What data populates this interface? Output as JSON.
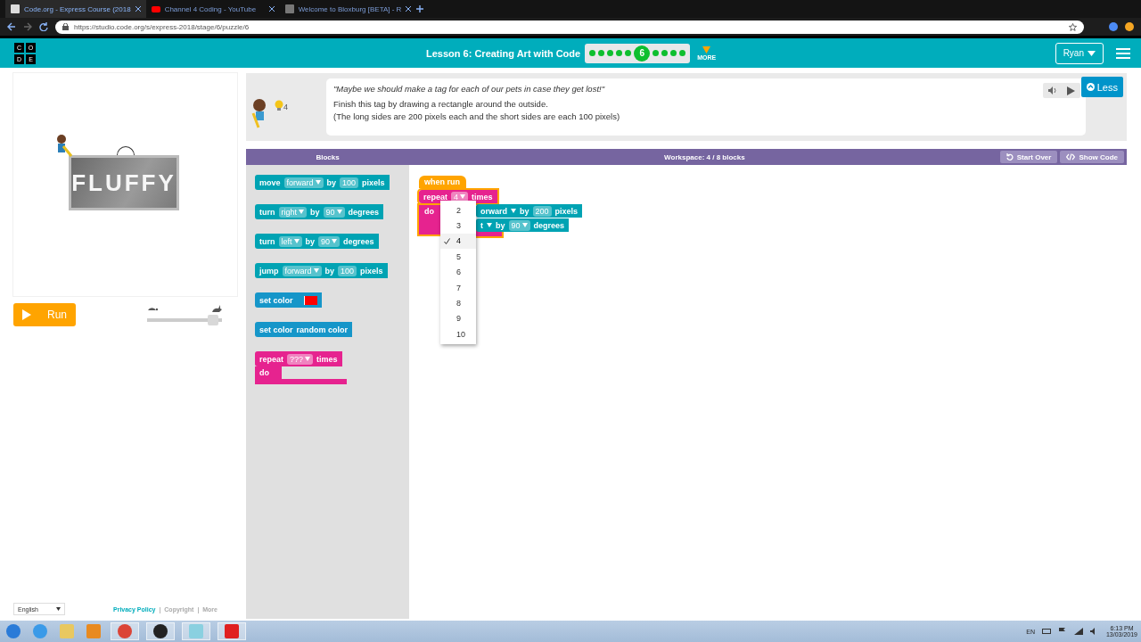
{
  "browser": {
    "tabs": [
      {
        "title": "Code.org - Express Course (2018",
        "selected": true
      },
      {
        "title": "Channel 4 Coding - YouTube",
        "selected": false
      },
      {
        "title": "Welcome to Bloxburg [BETA] - R",
        "selected": false
      }
    ],
    "url": "https://studio.code.org/s/express-2018/stage/6/puzzle/6"
  },
  "header": {
    "logo": [
      "C",
      "O",
      "D",
      "E"
    ],
    "lesson_title": "Lesson 6: Creating Art with Code",
    "progress": [
      {
        "selected": false
      },
      {
        "selected": false
      },
      {
        "selected": false
      },
      {
        "selected": false
      },
      {
        "selected": false
      },
      {
        "selected": true,
        "label": "6"
      },
      {
        "selected": false
      },
      {
        "selected": false
      },
      {
        "selected": false
      },
      {
        "selected": false
      }
    ],
    "more_label": "MORE",
    "user": "Ryan"
  },
  "stage": {
    "tag_text": "FLUFFY",
    "run_button": "Run",
    "speed": {
      "level": 0.88
    }
  },
  "instructions": {
    "hint_count": "4",
    "quote": "\"Maybe we should make a tag for each of our pets in case they get lost!\"",
    "lines": [
      "Finish this tag by drawing a rectangle around the outside.",
      "(The long sides are 200 pixels each and the short sides are each 100 pixels)"
    ],
    "less_button": "Less"
  },
  "toolbox": {
    "title": "Blocks",
    "blocks": [
      {
        "kind": "action",
        "parts": [
          {
            "kind": "text",
            "text": "move"
          },
          {
            "kind": "dropdown",
            "text": "forward"
          },
          {
            "kind": "text",
            "text": "by"
          },
          {
            "kind": "number",
            "text": "100"
          },
          {
            "kind": "text",
            "text": "pixels"
          }
        ]
      },
      {
        "kind": "action",
        "parts": [
          {
            "kind": "text",
            "text": "turn"
          },
          {
            "kind": "dropdown",
            "text": "right"
          },
          {
            "kind": "text",
            "text": "by"
          },
          {
            "kind": "dropdown",
            "text": "90"
          },
          {
            "kind": "text",
            "text": "degrees"
          }
        ]
      },
      {
        "kind": "action",
        "parts": [
          {
            "kind": "text",
            "text": "turn"
          },
          {
            "kind": "dropdown",
            "text": "left"
          },
          {
            "kind": "text",
            "text": "by"
          },
          {
            "kind": "dropdown",
            "text": "90"
          },
          {
            "kind": "text",
            "text": "degrees"
          }
        ]
      },
      {
        "kind": "action",
        "parts": [
          {
            "kind": "text",
            "text": "jump"
          },
          {
            "kind": "dropdown",
            "text": "forward"
          },
          {
            "kind": "text",
            "text": "by"
          },
          {
            "kind": "number",
            "text": "100"
          },
          {
            "kind": "text",
            "text": "pixels"
          }
        ]
      },
      {
        "kind": "color",
        "parts": [
          {
            "kind": "text",
            "text": "set color"
          },
          {
            "kind": "swatch",
            "color": "#ff0000"
          }
        ]
      },
      {
        "kind": "color",
        "parts": [
          {
            "kind": "text",
            "text": "set color"
          },
          {
            "kind": "text",
            "text": "random color"
          }
        ]
      },
      {
        "kind": "loop",
        "parts": [
          {
            "kind": "text",
            "text": "repeat"
          },
          {
            "kind": "dropdown",
            "text": "???"
          },
          {
            "kind": "text",
            "text": "times"
          }
        ],
        "do_label": "do"
      }
    ]
  },
  "workspace": {
    "title": "Workspace: 4 / 8 blocks",
    "buttons": [
      {
        "kind": "reset",
        "label": "Start Over"
      },
      {
        "kind": "code",
        "label": "Show Code"
      }
    ],
    "start_block": "when run",
    "repeat_block": {
      "parts": [
        {
          "kind": "text",
          "text": "repeat"
        },
        {
          "kind": "dropdown",
          "text": "4"
        },
        {
          "kind": "text",
          "text": "times"
        }
      ],
      "do_label": "do"
    },
    "inner_blocks": [
      {
        "parts": [
          {
            "kind": "text",
            "text": "orward"
          },
          {
            "kind": "arrow"
          },
          {
            "kind": "text",
            "text": "by"
          },
          {
            "kind": "number",
            "text": "200"
          },
          {
            "kind": "text",
            "text": "pixels"
          }
        ]
      },
      {
        "parts": [
          {
            "kind": "text",
            "text": "t"
          },
          {
            "kind": "arrow"
          },
          {
            "kind": "text",
            "text": "by"
          },
          {
            "kind": "dropdown",
            "text": "90"
          },
          {
            "kind": "text",
            "text": "degrees"
          }
        ]
      }
    ],
    "dropdown_options": [
      {
        "label": "2",
        "selected": false
      },
      {
        "label": "3",
        "selected": false
      },
      {
        "label": "4",
        "selected": true
      },
      {
        "label": "5",
        "selected": false
      },
      {
        "label": "6",
        "selected": false
      },
      {
        "label": "7",
        "selected": false
      },
      {
        "label": "8",
        "selected": false
      },
      {
        "label": "9",
        "selected": false
      },
      {
        "label": "10",
        "selected": false
      }
    ]
  },
  "footer": {
    "language": "English",
    "links": [
      {
        "text": "Privacy Policy"
      },
      {
        "separator": "|",
        "text": "Copyright"
      },
      {
        "separator": "|",
        "text": "More"
      }
    ]
  },
  "taskbar": {
    "language": "EN",
    "time": "6:13 PM",
    "date": "13/03/2019"
  }
}
